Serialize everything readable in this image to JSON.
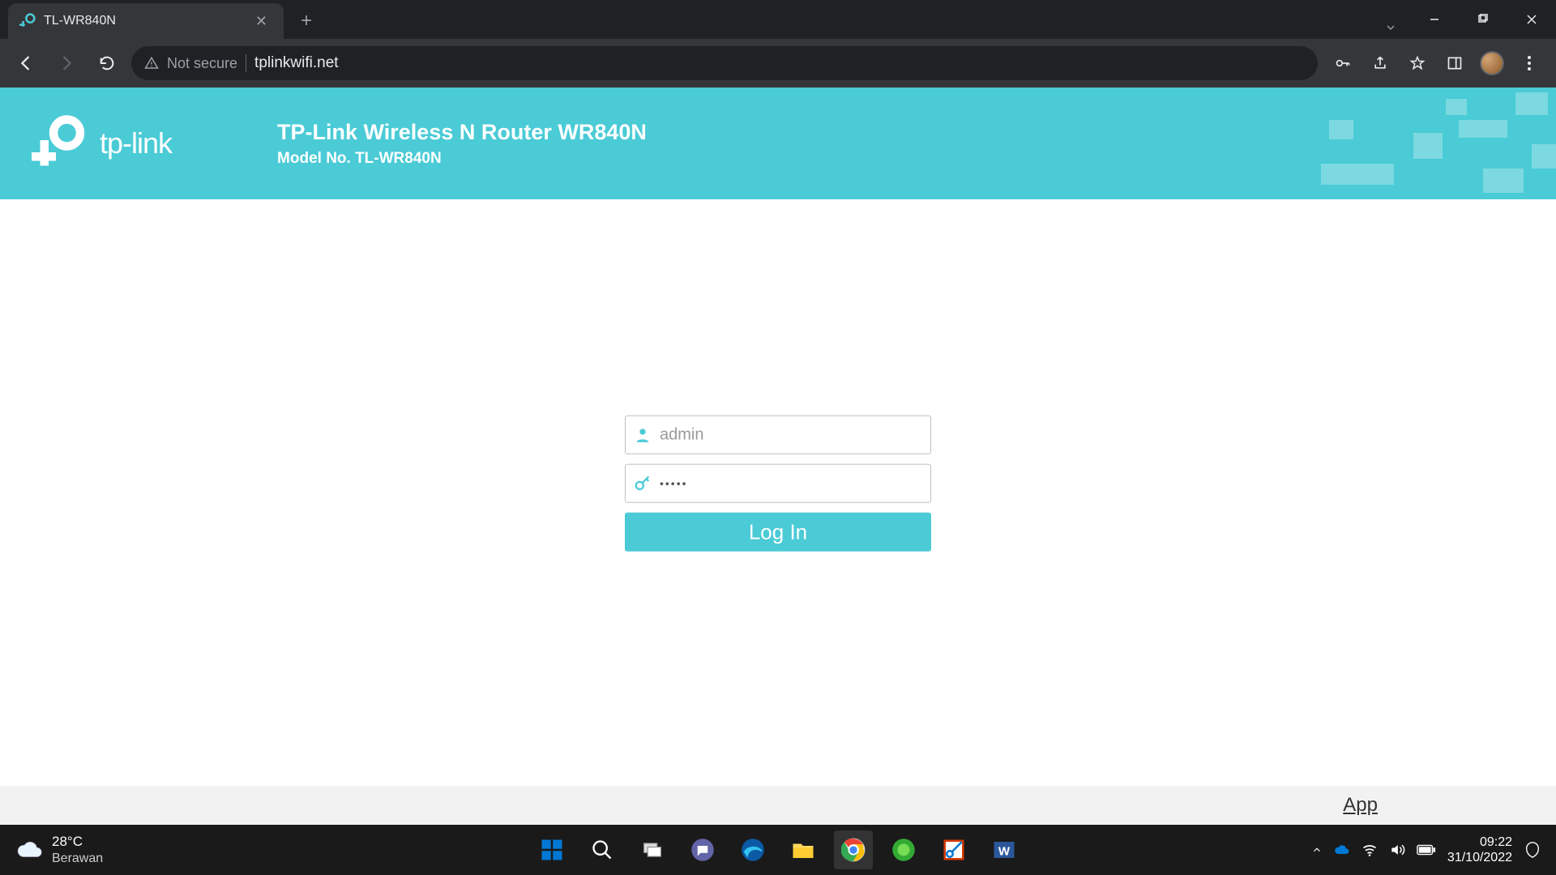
{
  "browser": {
    "tab_title": "TL-WR840N",
    "not_secure_label": "Not secure",
    "url": "tplinkwifi.net"
  },
  "banner": {
    "logo_text": "tp-link",
    "title": "TP-Link Wireless N Router WR840N",
    "model": "Model No. TL-WR840N"
  },
  "login": {
    "username_placeholder": "admin",
    "username_value": "",
    "password_value": "•••••",
    "button_label": "Log In"
  },
  "footer": {
    "app_link": "App"
  },
  "taskbar": {
    "weather_temp": "28°C",
    "weather_cond": "Berawan",
    "time": "09:22",
    "date": "31/10/2022"
  }
}
